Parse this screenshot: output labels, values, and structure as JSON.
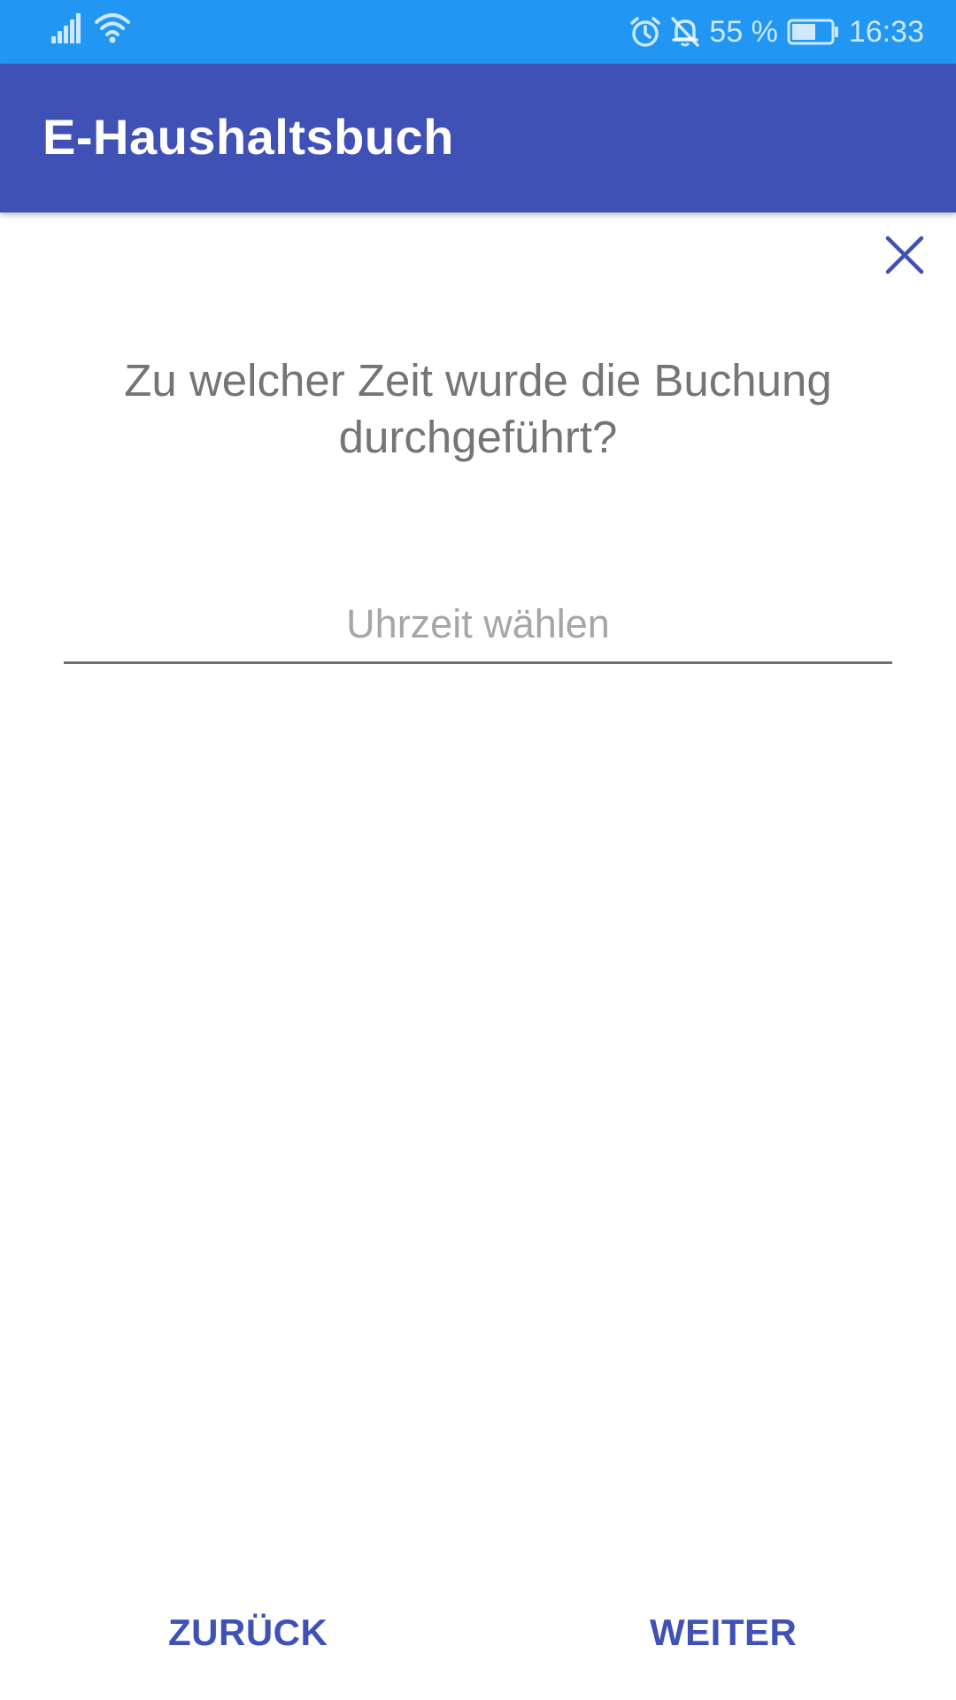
{
  "status_bar": {
    "icons": [
      "signal-icon",
      "wifi-icon",
      "alarm-icon",
      "bell-off-icon",
      "battery-icon"
    ],
    "battery": "55 %",
    "time": "16:33",
    "background": "#2196f3"
  },
  "app_bar": {
    "title": "E-Haushaltsbuch",
    "background": "#3f51b5"
  },
  "dialog": {
    "close_icon": "close-icon",
    "question": "Zu welcher Zeit wurde die Buchung durchgeführt?",
    "time_input": {
      "value": "",
      "placeholder": "Uhrzeit wählen"
    }
  },
  "navigation": {
    "back_label": "ZURÜCK",
    "next_label": "WEITER"
  },
  "colors": {
    "accent": "#3f51b5",
    "question_text": "#757575"
  }
}
